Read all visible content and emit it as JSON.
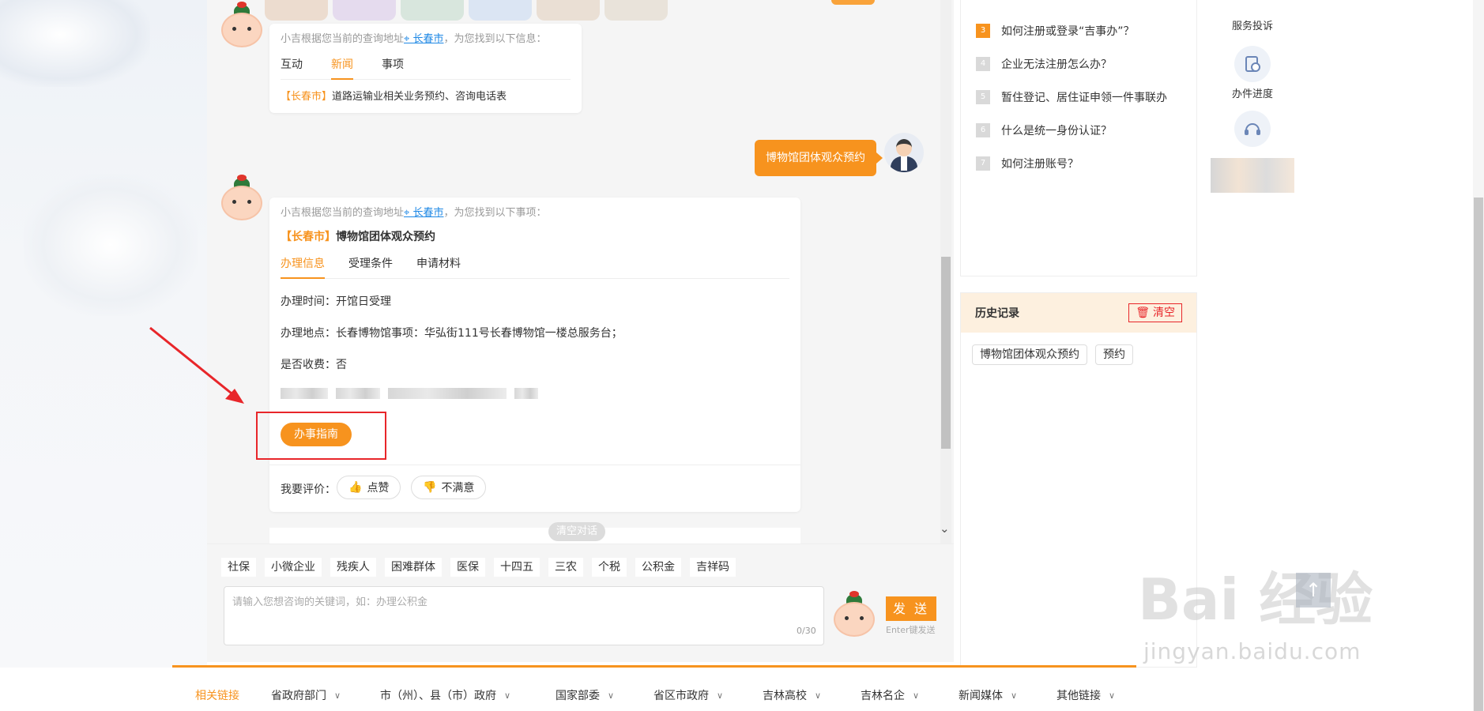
{
  "chat": {
    "msg1": {
      "hint_prefix": "小吉根据您当前的查询地址",
      "location": "长春市",
      "hint_suffix": "，为您找到以下信息：",
      "tabs": [
        "互动",
        "新闻",
        "事项"
      ],
      "active_tab": "新闻",
      "item_city": "【长春市】",
      "item_text": "道路运输业相关业务预约、咨询电话表"
    },
    "user_msg": "博物馆团体观众预约",
    "msg2": {
      "hint_prefix": "小吉根据您当前的查询地址",
      "location": "长春市",
      "hint_suffix": "，为您找到以下事项：",
      "title_city": "【长春市】",
      "title_text": "博物馆团体观众预约",
      "tabs": [
        "办理信息",
        "受理条件",
        "申请材料"
      ],
      "active_tab": "办理信息",
      "time_label": "办理时间：",
      "time_value": "开馆日受理",
      "place_label": "办理地点：",
      "place_value": "长春博物馆事项：华弘街111号长春博物馆一楼总服务台；",
      "fee_label": "是否收费：",
      "fee_value": "否",
      "guide_button": "办事指南",
      "rate_label": "我要评价：",
      "like_button": "点赞",
      "dislike_button": "不满意"
    },
    "clear_chat_button": "清空对话"
  },
  "input": {
    "quick_tags": [
      "社保",
      "小微企业",
      "残疾人",
      "困难群体",
      "医保",
      "十四五",
      "三农",
      "个税",
      "公积金",
      "吉祥码"
    ],
    "placeholder": "请输入您想咨询的关键词，如：办理公积金",
    "counter": "0/30",
    "send_button": "发 送",
    "send_hint": "Enter键发送"
  },
  "faq": {
    "items": [
      {
        "num": "3",
        "text": "如何注册或登录“吉事办”？"
      },
      {
        "num": "4",
        "text": "企业无法注册怎么办？"
      },
      {
        "num": "5",
        "text": "暂住登记、居住证申领一件事联办"
      },
      {
        "num": "6",
        "text": "什么是统一身份认证？"
      },
      {
        "num": "7",
        "text": "如何注册账号？"
      }
    ]
  },
  "history": {
    "title": "历史记录",
    "clear_button": "清空",
    "tags": [
      "博物馆团体观众预约",
      "预约"
    ]
  },
  "side": {
    "complaint": "服务投诉",
    "progress": "办件进度"
  },
  "footer": {
    "items": [
      "相关链接",
      "省政府部门",
      "市（州）、县（市）政府",
      "国家部委",
      "省区市政府",
      "吉林高校",
      "吉林名企",
      "新闻媒体",
      "其他链接"
    ]
  },
  "watermark": {
    "brand": "Bai 经验",
    "url": "jingyan.baidu.com"
  },
  "colors": {
    "accent": "#f7931e",
    "highlight_red": "#e8262a",
    "link_blue": "#1e88e5"
  }
}
